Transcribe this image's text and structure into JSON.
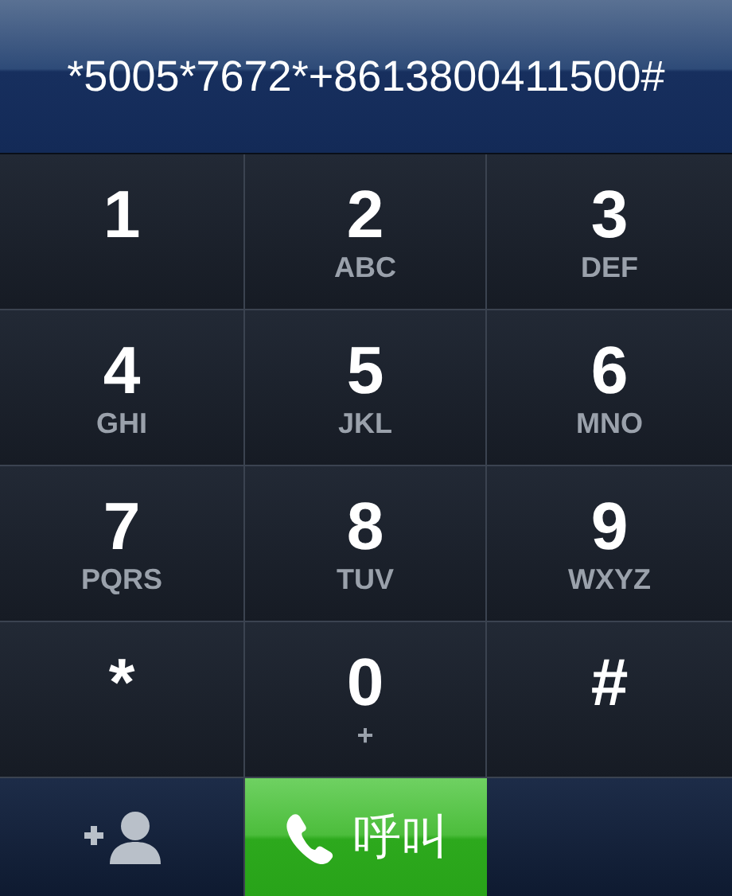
{
  "display": {
    "number": "*5005*7672*+8613800411500#"
  },
  "keys": [
    {
      "digit": "1"
    },
    {
      "digit": "2",
      "letters": "ABC"
    },
    {
      "digit": "3",
      "letters": "DEF"
    },
    {
      "digit": "4",
      "letters": "GHI"
    },
    {
      "digit": "5",
      "letters": "JKL"
    },
    {
      "digit": "6",
      "letters": "MNO"
    },
    {
      "digit": "7",
      "letters": "PQRS"
    },
    {
      "digit": "8",
      "letters": "TUV"
    },
    {
      "digit": "9",
      "letters": "WXYZ"
    },
    {
      "digit": "*"
    },
    {
      "digit": "0",
      "letters": "+"
    },
    {
      "digit": "#"
    }
  ],
  "call_button": {
    "label": "呼叫"
  }
}
